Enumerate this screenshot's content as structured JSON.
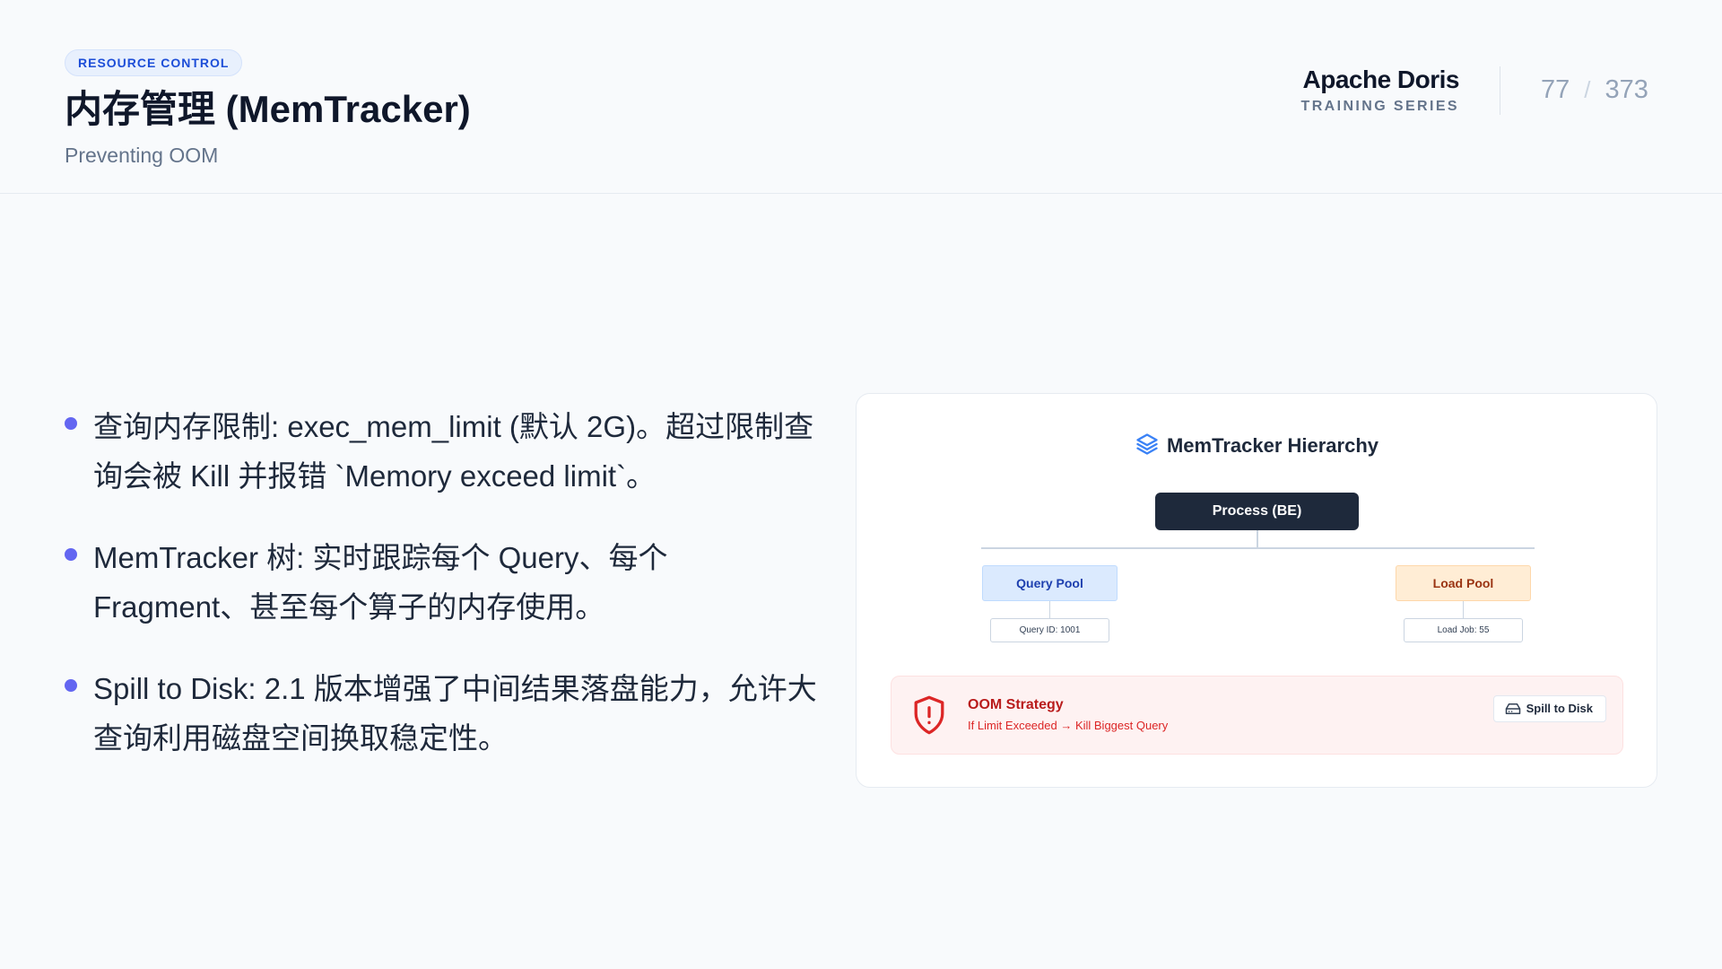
{
  "header": {
    "tag": "RESOURCE CONTROL",
    "title": "内存管理 (MemTracker)",
    "subtitle": "Preventing OOM",
    "brand_name": "Apache Doris",
    "brand_sub": "TRAINING SERIES",
    "page_current": "77",
    "page_sep": "/",
    "page_total": "373"
  },
  "bullets": [
    "查询内存限制: exec_mem_limit (默认 2G)。超过限制查询会被 Kill 并报错 `Memory exceed limit`。",
    "MemTracker 树: 实时跟踪每个 Query、每个 Fragment、甚至每个算子的内存使用。",
    "Spill to Disk: 2.1 版本增强了中间结果落盘能力，允许大查询利用磁盘空间换取稳定性。"
  ],
  "diagram": {
    "title": "MemTracker Hierarchy",
    "title_icon": "layers-icon",
    "root": "Process (BE)",
    "query_pool": "Query Pool",
    "load_pool": "Load Pool",
    "query_leaf": "Query ID: 1001",
    "load_leaf": "Load Job: 55",
    "oom": {
      "icon": "shield-alert-icon",
      "title": "OOM Strategy",
      "desc": "If Limit Exceeded → Kill Biggest Query",
      "button": "Spill to Disk",
      "button_icon": "hard-drive-icon"
    }
  },
  "colors": {
    "accent_dot": "#6366f1",
    "tag_text": "#1d4ed8",
    "oom_red": "#dc2626",
    "query_pool_bg": "#dbeafe",
    "load_pool_bg": "#ffedd5"
  }
}
